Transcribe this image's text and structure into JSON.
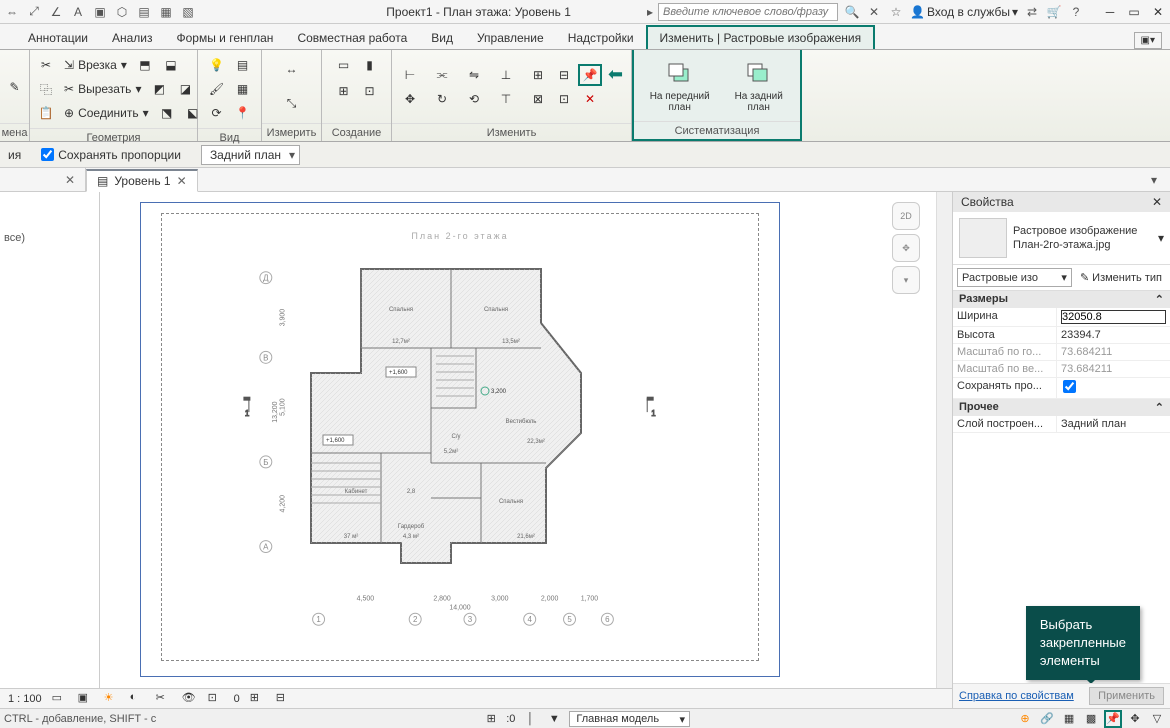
{
  "titlebar": {
    "title": "Проект1 - План этажа: Уровень 1",
    "search_placeholder": "Введите ключевое слово/фразу",
    "login": "Вход в службы"
  },
  "ribbon": {
    "tabs": [
      "Аннотации",
      "Анализ",
      "Формы и генплан",
      "Совместная работа",
      "Вид",
      "Управление",
      "Надстройки",
      "Изменить | Растровые изображения"
    ],
    "panel_change": {
      "insert": "Врезка",
      "cut": "Вырезать",
      "join": "Соединить"
    },
    "panel_labels": {
      "p0": "мена",
      "geom": "Геометрия",
      "view": "Вид",
      "measure": "Измерить",
      "create": "Создание",
      "modify": "Изменить",
      "arrange": "Систематизация"
    },
    "bring_front": "На передний\nплан",
    "send_back": "На задний\nплан"
  },
  "options": {
    "row_label_left": "ия",
    "keep_proportions": "Сохранять пропорции",
    "layer_select": "Задний план"
  },
  "doctabs": {
    "tab1": "Уровень 1"
  },
  "leftpanel": {
    "label": "все)"
  },
  "plan": {
    "title": "План 2-го этажа",
    "rooms": {
      "bedroom1": "Спальня",
      "bedroom2": "Спальня",
      "bedroom3": "Спальня",
      "cabinet": "Кабинет",
      "wardrobe": "Гардероб",
      "vestibule": "Вестибюль",
      "wc": "С/у"
    },
    "dims": {
      "d_12_7": "12,7м²",
      "d_13_5": "13,5м²",
      "d_22_3": "22,3м²",
      "d_21_6": "21,6м²",
      "d_37": "37 м²",
      "d_4_3": "4,3 м²",
      "d_5_2": "5,2м²",
      "d_2_8": "2,8"
    },
    "levels": {
      "l3200": "3,200",
      "l1600a": "+1,600",
      "l1600b": "+1,600"
    },
    "outer_dims": {
      "d3900": "3,900",
      "d5100": "5,100",
      "d4200": "4,200",
      "d13200": "13,200",
      "d4500": "4,500",
      "d2800": "2,800",
      "d3000": "3,000",
      "d2000": "2,000",
      "d1700": "1,700",
      "d14000": "14,000"
    },
    "grid_1": "1",
    "grid_2": "2",
    "grid_3": "3",
    "grid_4": "4",
    "grid_5": "5",
    "grid_6": "6",
    "grid_A": "А",
    "grid_B": "Б",
    "grid_V": "В",
    "grid_D": "Д"
  },
  "props": {
    "title": "Свойства",
    "type_name": "Растровое изображение",
    "type_sub": "План-2го-этажа.jpg",
    "filter": "Растровые изо",
    "edit_type": "Изменить тип",
    "group_dim": "Размеры",
    "width_l": "Ширина",
    "width_v": "32050.8",
    "height_l": "Высота",
    "height_v": "23394.7",
    "scale_h_l": "Масштаб по го...",
    "scale_h_v": "73.684211",
    "scale_v_l": "Масштаб по ве...",
    "scale_v_v": "73.684211",
    "keep_l": "Сохранять про...",
    "group_other": "Прочее",
    "layer_l": "Слой построен...",
    "layer_v": "Задний план",
    "help": "Справка по свойствам",
    "apply": "Применить"
  },
  "tooltip": {
    "l1": "Выбрать",
    "l2": "закрепленные",
    "l3": "элементы"
  },
  "viewbar": {
    "scale": "1 : 100",
    "sb_num": "0"
  },
  "statusbar": {
    "left": "CTRL - добавление, SHIFT - с",
    "zero": ":0",
    "model": "Главная модель"
  }
}
